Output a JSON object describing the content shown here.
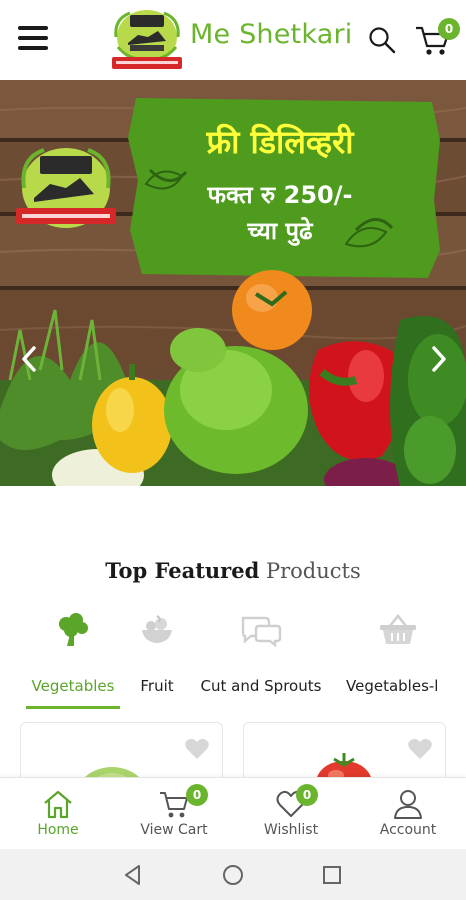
{
  "header": {
    "brand_name": "Me Shetkari",
    "cart_count": "0",
    "logo_lettering": "मी शेतकरी"
  },
  "banner": {
    "promo_title": "फ्री डिलिव्हरी",
    "promo_line2": "फक्त रु 250/-",
    "promo_line3": "च्या पुढे"
  },
  "section": {
    "title_strong": "Top Featured",
    "title_light": " Products"
  },
  "categories": [
    {
      "label": "Vegetables",
      "icon": "broccoli-icon",
      "active": true
    },
    {
      "label": "Fruit",
      "icon": "fruit-bowl-icon",
      "active": false
    },
    {
      "label": "Cut and Sprouts",
      "icon": "chat-bubbles-icon",
      "active": false
    },
    {
      "label": "Vegetables-l",
      "icon": "basket-icon",
      "active": false
    }
  ],
  "bottom_nav": [
    {
      "label": "Home",
      "icon": "home-icon",
      "active": true
    },
    {
      "label": "View Cart",
      "icon": "cart-icon",
      "badge": "0"
    },
    {
      "label": "Wishlist",
      "icon": "heart-icon",
      "badge": "0"
    },
    {
      "label": "Account",
      "icon": "user-icon"
    }
  ],
  "colors": {
    "accent": "#6bb52e",
    "promo_yellow": "#ffff3a",
    "promo_green": "#4e9b1e"
  }
}
